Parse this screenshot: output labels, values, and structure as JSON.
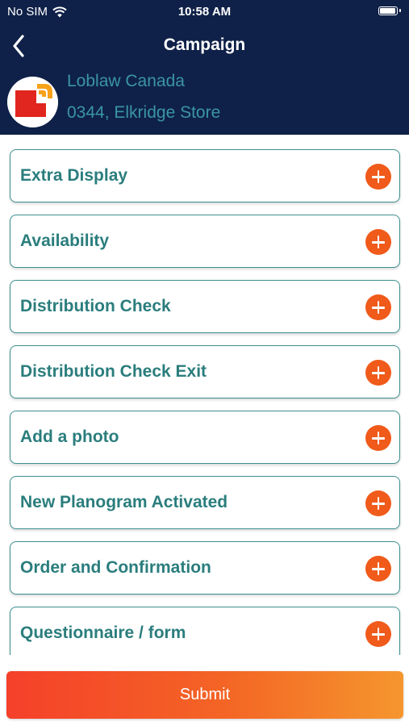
{
  "status_bar": {
    "carrier": "No SIM",
    "time": "10:58 AM"
  },
  "header": {
    "title": "Campaign",
    "store_name": "Loblaw Canada",
    "store_address": "0344, Elkridge Store"
  },
  "items": [
    {
      "label": "Extra Display"
    },
    {
      "label": "Availability"
    },
    {
      "label": "Distribution Check"
    },
    {
      "label": "Distribution Check Exit"
    },
    {
      "label": "Add a photo"
    },
    {
      "label": "New Planogram Activated"
    },
    {
      "label": "Order and Confirmation"
    },
    {
      "label": "Questionnaire / form"
    }
  ],
  "submit_label": "Submit",
  "colors": {
    "header_bg": "#0f2148",
    "accent_teal": "#2b7d7d",
    "plus_orange": "#f05a1a",
    "store_text": "#3b95a3"
  }
}
